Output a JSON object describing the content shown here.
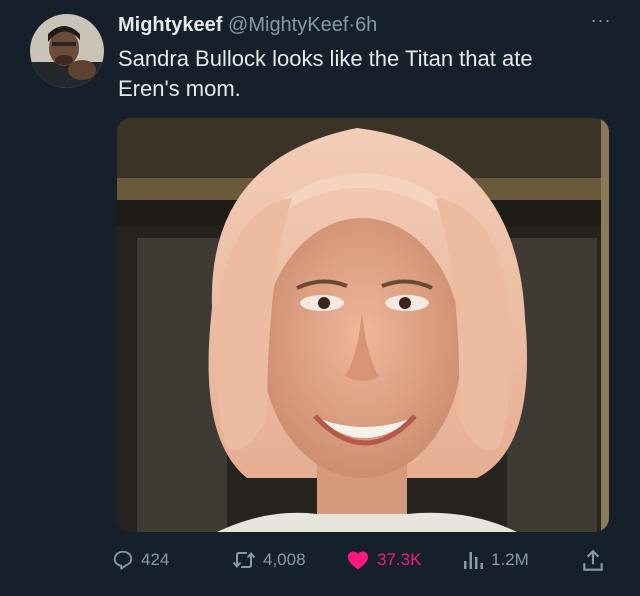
{
  "author": {
    "name": "Mightykeef",
    "handle": "@MightyKeef",
    "separator": "·",
    "time": "6h"
  },
  "tweet": {
    "line1": "Sandra Bullock looks like the Titan that ate",
    "line2": "Eren's mom."
  },
  "more_label": "···",
  "actions": {
    "replies": "424",
    "retweets": "4,008",
    "likes": "37.3K",
    "views": "1.2M"
  },
  "icons": {
    "reply": "reply-icon",
    "retweet": "retweet-icon",
    "like": "heart-icon",
    "views": "views-icon",
    "share": "share-icon",
    "more": "more-icon"
  },
  "colors": {
    "background": "#15202b",
    "primary_text": "#e7e9ea",
    "secondary_text": "#8b98a5",
    "like_active": "#f91880"
  }
}
